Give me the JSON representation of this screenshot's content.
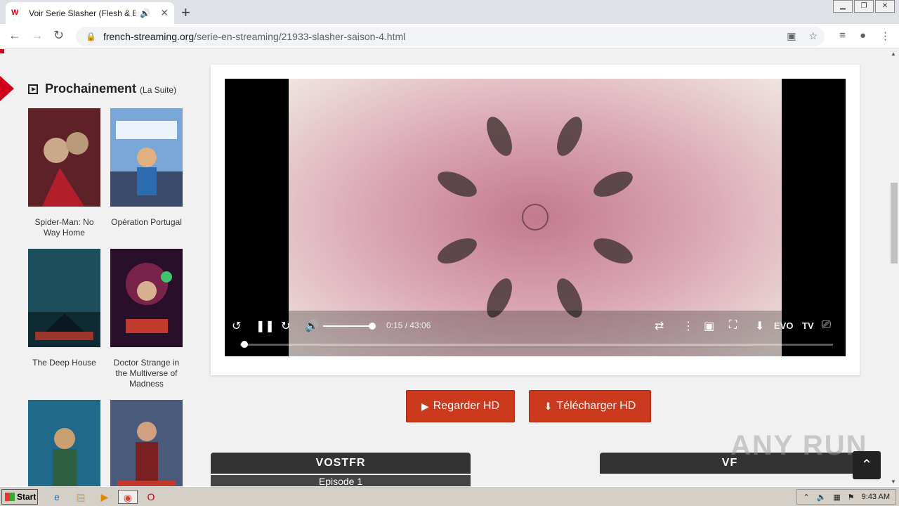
{
  "browser": {
    "tab_title": "Voir Serie Slasher (Flesh & Blood)",
    "favicon_text": "W",
    "new_tab": "+",
    "url_host": "french-streaming.org",
    "url_path": "/serie-en-streaming/21933-slasher-saison-4.html"
  },
  "sidebar": {
    "title": "Prochainement",
    "subtitle": "(La Suite)",
    "items": [
      {
        "title": "Spider-Man: No Way Home",
        "color": "#8b1a1a"
      },
      {
        "title": "Opération Portugal",
        "color": "#2b6cb0"
      },
      {
        "title": "The Deep House",
        "color": "#1d4e5c"
      },
      {
        "title": "Doctor Strange in the Multiverse of Madness",
        "color": "#6b1f3a"
      },
      {
        "title": "",
        "color": "#1f6a8a"
      },
      {
        "title": "",
        "color": "#4a5a7a"
      }
    ]
  },
  "player": {
    "time": "0:15 / 43:06",
    "volume": 0.95,
    "progress": 0.006,
    "evo_label": "EVO",
    "tv_label": "TV"
  },
  "buttons": {
    "watch": "Regarder HD",
    "download": "Télécharger HD"
  },
  "episodes": {
    "vostfr_label": "VOSTFR",
    "vostfr_first": "Episode 1",
    "vf_label": "VF"
  },
  "watermark": "ANY RUN",
  "taskbar": {
    "start": "Start",
    "time": "9:43 AM"
  }
}
